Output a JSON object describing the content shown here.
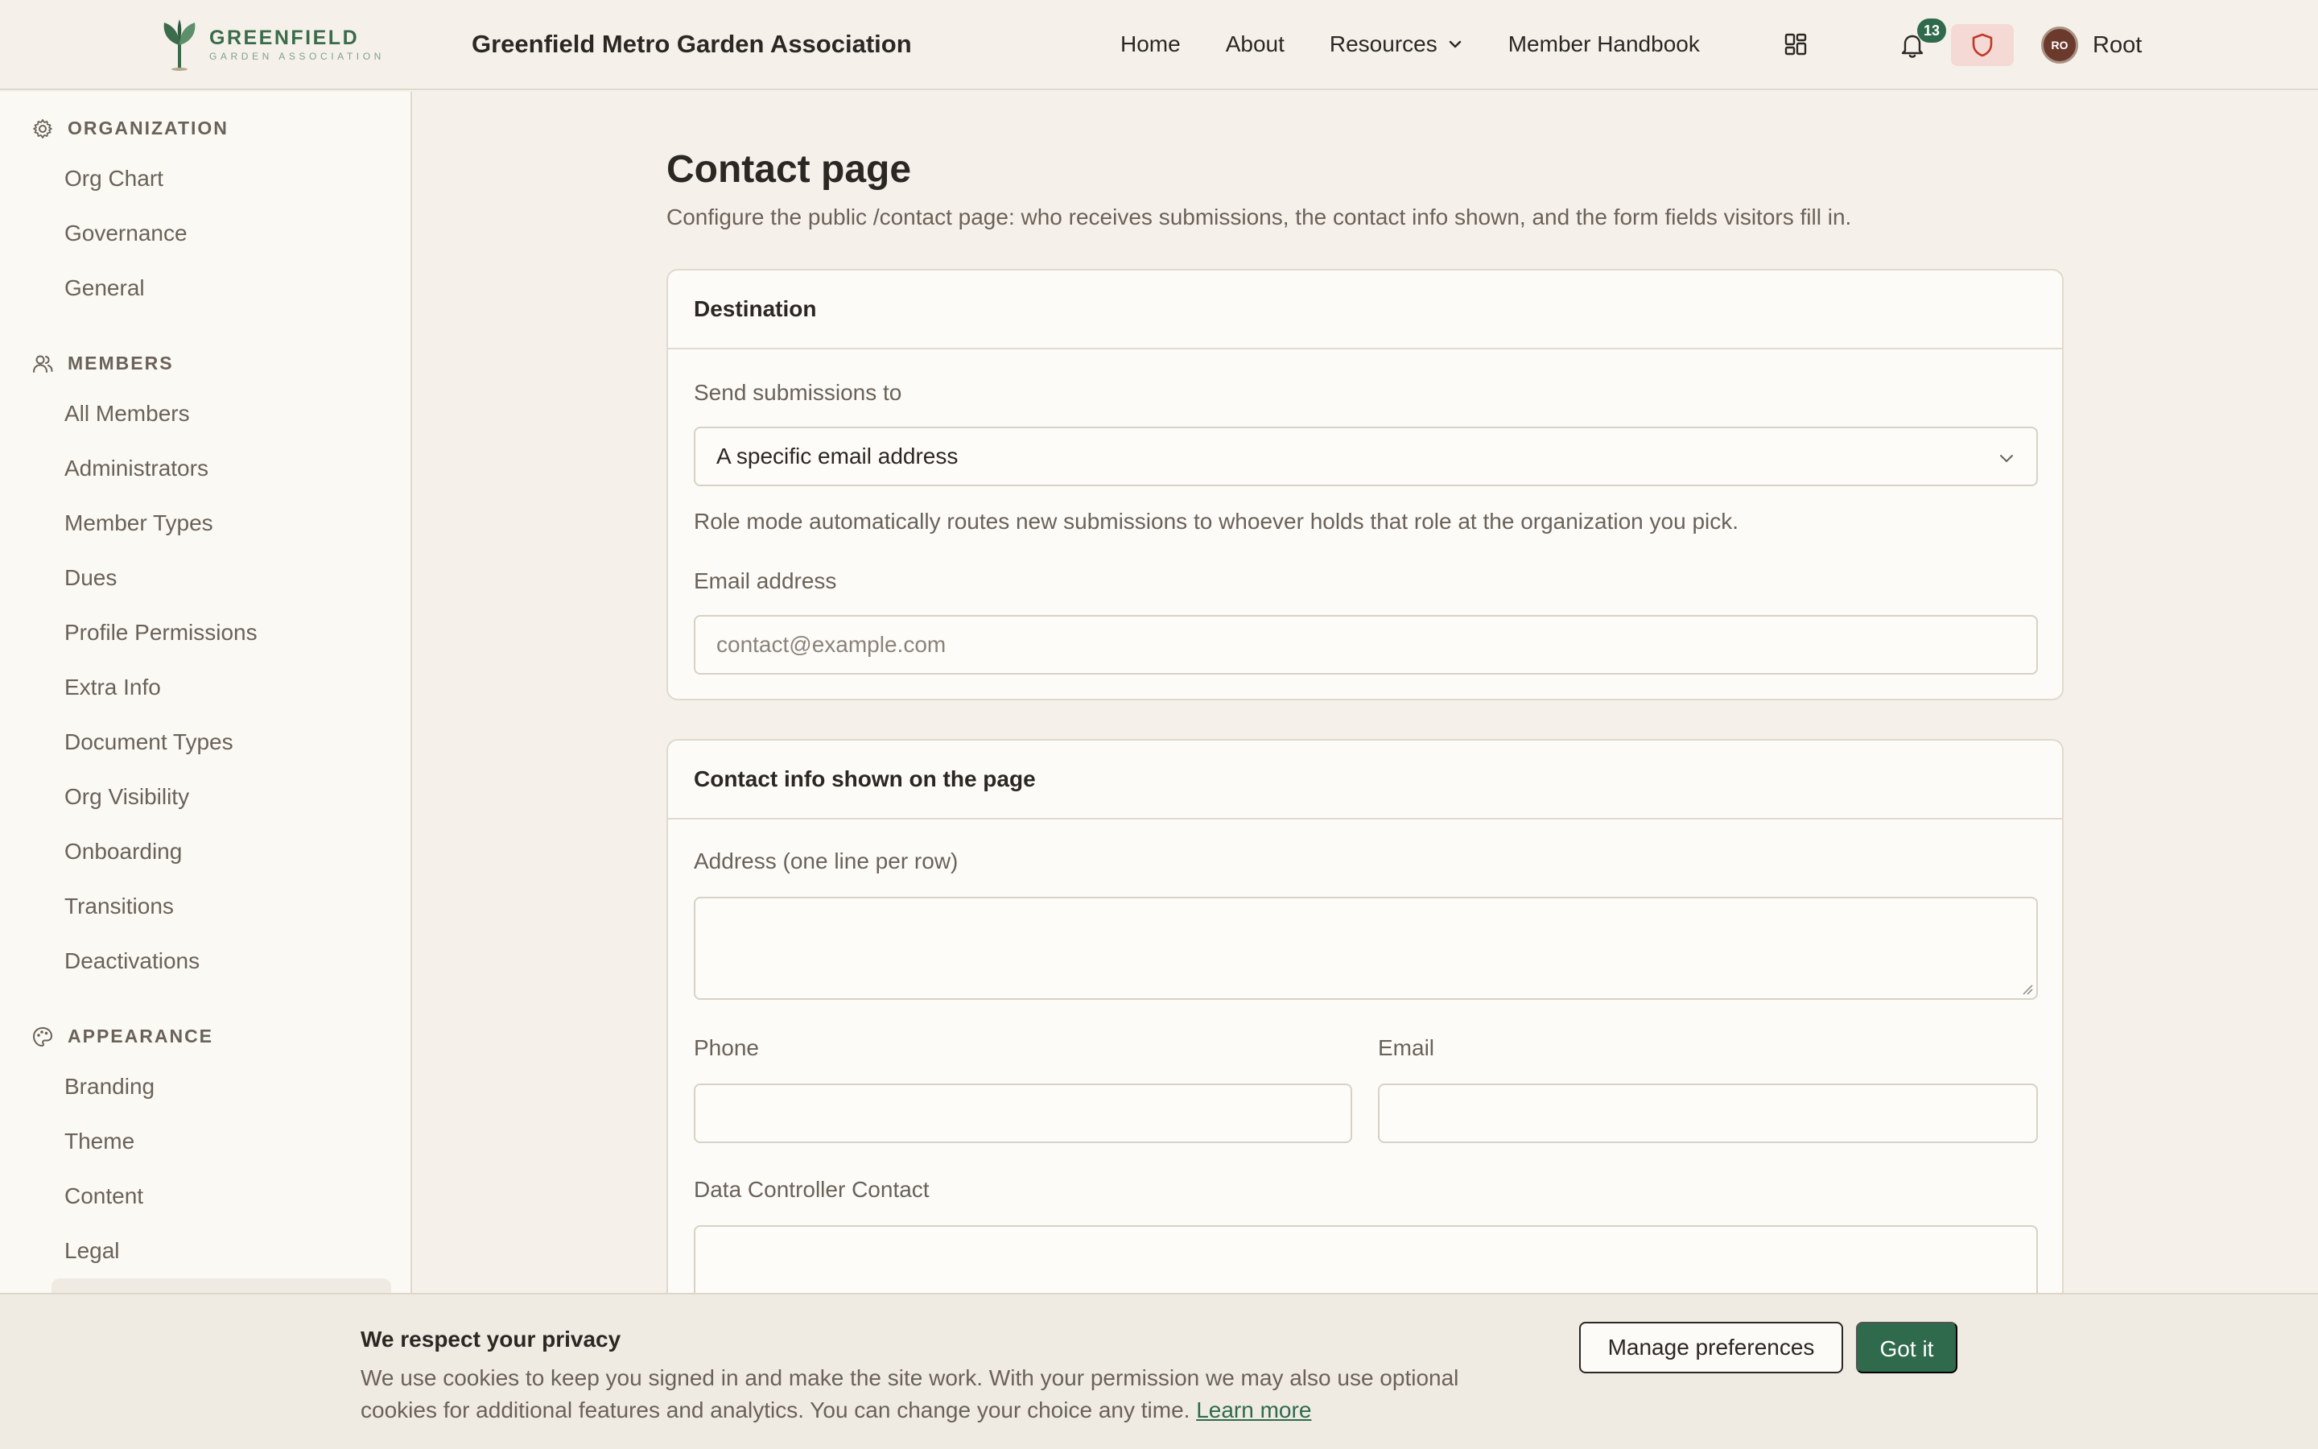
{
  "brand": {
    "logo_name": "GREENFIELD",
    "logo_sub": "GARDEN ASSOCIATION",
    "org_title": "Greenfield Metro Garden Association",
    "accent_color": "#2f6a4d"
  },
  "topnav": {
    "items": [
      "Home",
      "About",
      "Resources",
      "Member Handbook"
    ],
    "notification_count": "13",
    "user_initials": "RO",
    "user_name": "Root"
  },
  "sidebar": {
    "sections": [
      {
        "title": "ORGANIZATION",
        "icon": "gear-icon",
        "items": [
          "Org Chart",
          "Governance",
          "General"
        ]
      },
      {
        "title": "MEMBERS",
        "icon": "users-icon",
        "items": [
          "All Members",
          "Administrators",
          "Member Types",
          "Dues",
          "Profile Permissions",
          "Extra Info",
          "Document Types",
          "Org Visibility",
          "Onboarding",
          "Transitions",
          "Deactivations"
        ]
      },
      {
        "title": "APPEARANCE",
        "icon": "palette-icon",
        "items": [
          "Branding",
          "Theme",
          "Content",
          "Legal"
        ]
      }
    ]
  },
  "main": {
    "title": "Contact page",
    "description": "Configure the public /contact page: who receives submissions, the contact info shown, and the form fields visitors fill in.",
    "destination": {
      "heading": "Destination",
      "send_label": "Send submissions to",
      "send_value": "A specific email address",
      "help": "Role mode automatically routes new submissions to whoever holds that role at the organization you pick.",
      "email_label": "Email address",
      "email_placeholder": "contact@example.com"
    },
    "contact_info": {
      "heading": "Contact info shown on the page",
      "address_label": "Address (one line per row)",
      "phone_label": "Phone",
      "email_label": "Email",
      "controller_label": "Data Controller Contact"
    }
  },
  "cookie": {
    "title": "We respect your privacy",
    "text": "We use cookies to keep you signed in and make the site work. With your permission we may also use optional cookies for additional features and analytics. You can change your choice any time.",
    "link": "Learn more",
    "manage_button": "Manage preferences",
    "accept_button": "Got it"
  }
}
